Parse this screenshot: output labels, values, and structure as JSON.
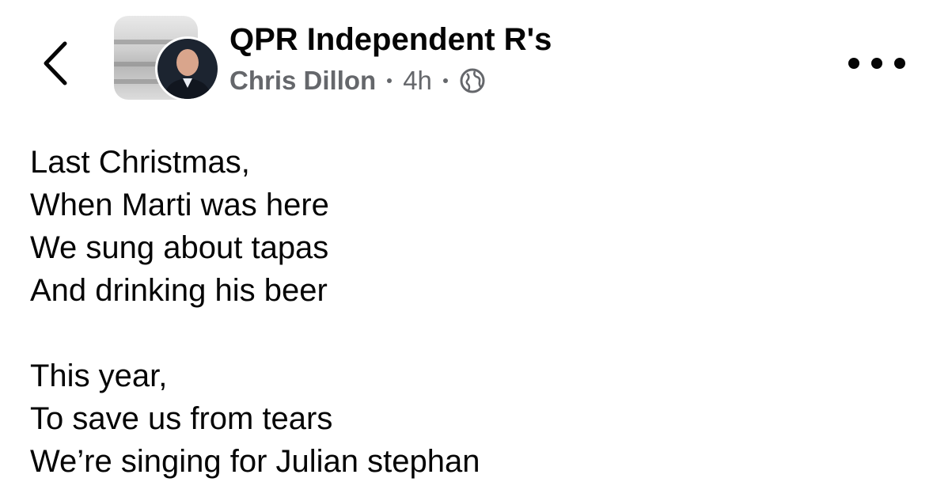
{
  "post": {
    "group_name": "QPR Independent R's",
    "author": "Chris Dillon",
    "time": "4h",
    "privacy_icon": "globe-icon",
    "stanzas": [
      [
        "Last Christmas,",
        "When Marti was here",
        "We sung about tapas",
        "And drinking his beer"
      ],
      [
        "This year,",
        "To save us from tears",
        "We’re singing for Julian stephan"
      ]
    ]
  },
  "icons": {
    "back": "chevron-left-icon",
    "more": "more-horizontal-icon"
  },
  "colors": {
    "text": "#050505",
    "secondary_text": "#65676b",
    "background": "#ffffff"
  }
}
